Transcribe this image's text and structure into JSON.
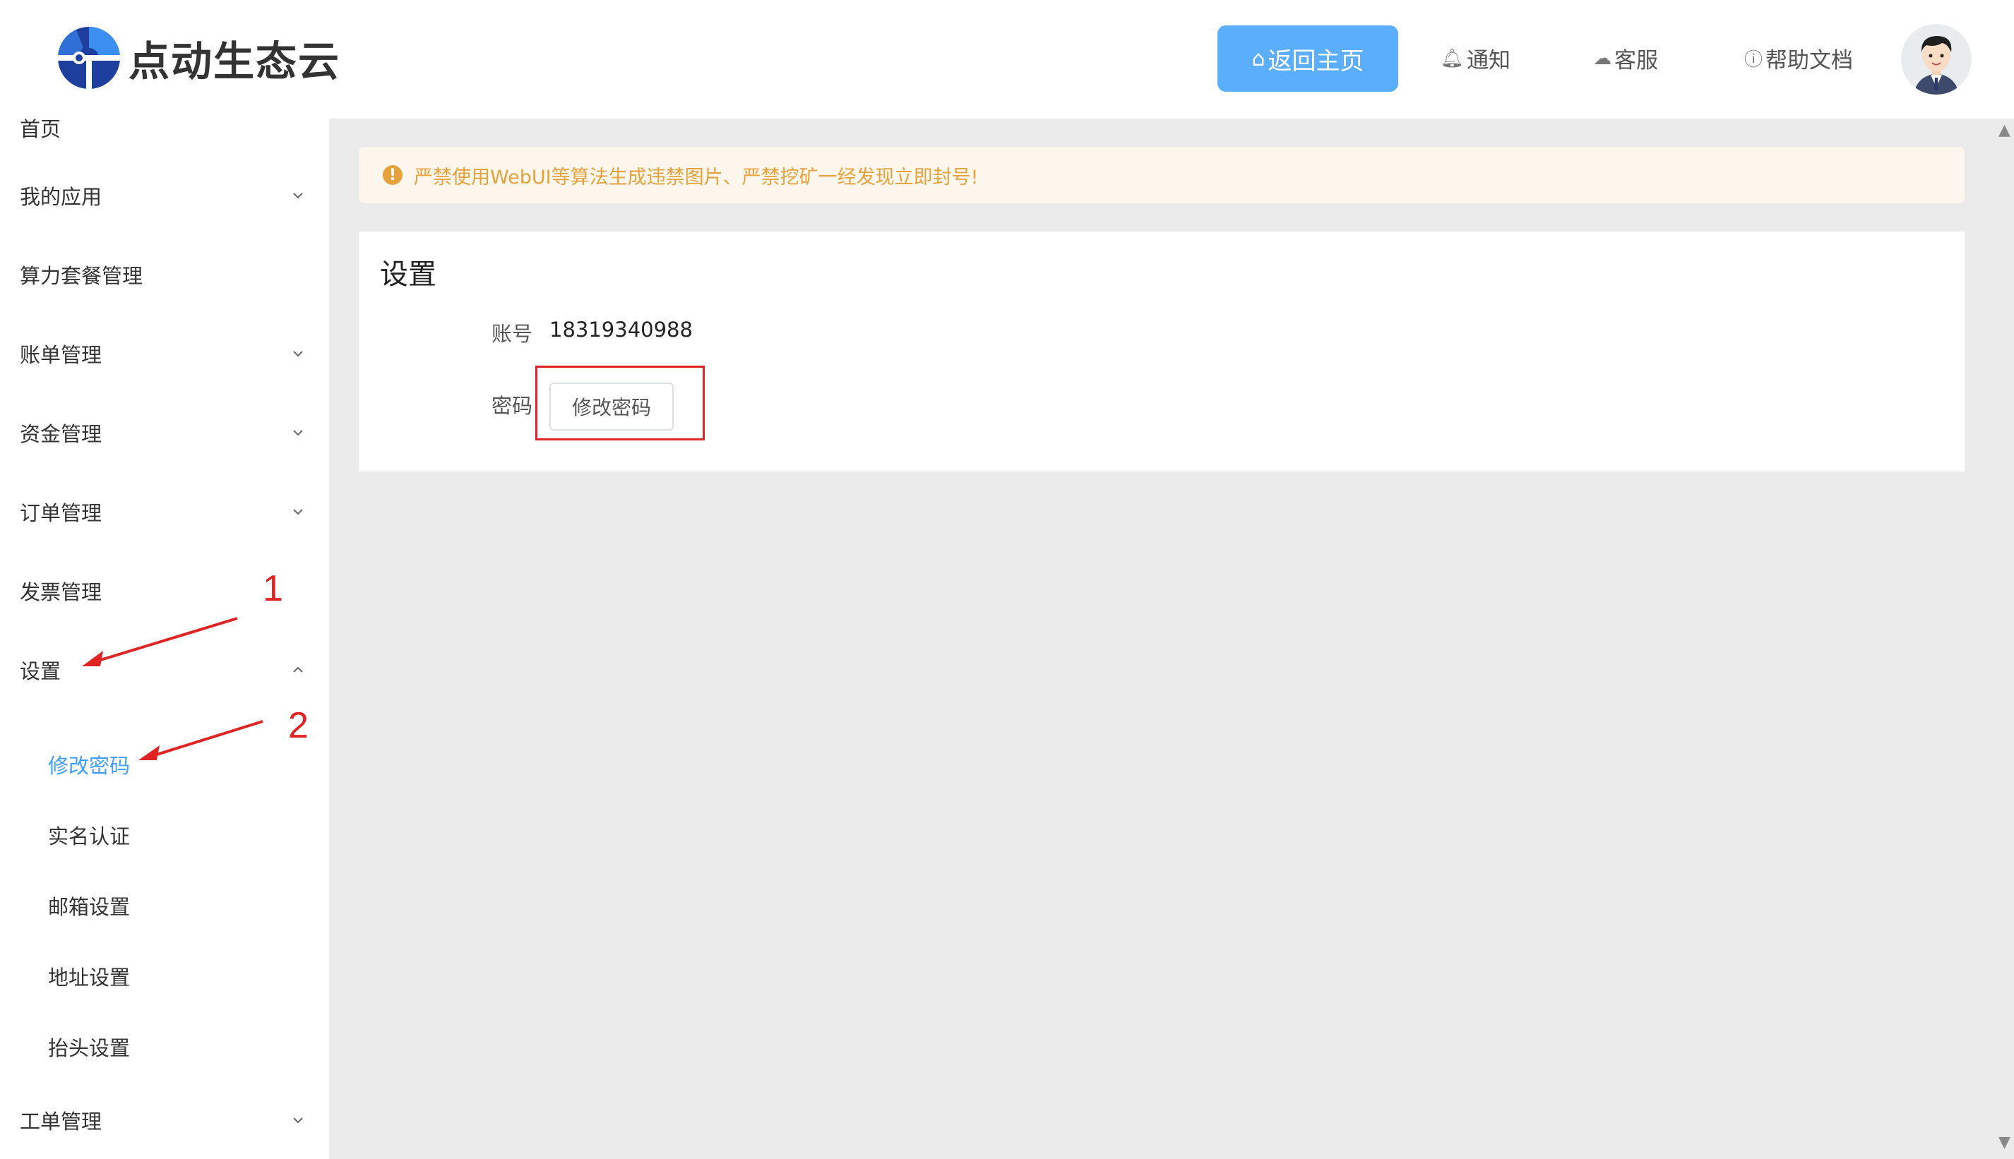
{
  "header": {
    "brand": "点动生态云",
    "home_label": "返回主页",
    "nav": [
      {
        "icon": "bell-icon",
        "label": "通知"
      },
      {
        "icon": "chat-icon",
        "label": "客服"
      },
      {
        "icon": "help-icon",
        "label": "帮助文档"
      }
    ]
  },
  "sidebar": {
    "partial_top": "首页",
    "items": [
      {
        "label": "我的应用"
      },
      {
        "label": "算力套餐管理"
      },
      {
        "label": "账单管理"
      },
      {
        "label": "资金管理"
      },
      {
        "label": "订单管理"
      },
      {
        "label": "发票管理"
      },
      {
        "label": "设置"
      },
      {
        "label": "工单管理"
      }
    ],
    "settings_sub": [
      {
        "label": "修改密码"
      },
      {
        "label": "实名认证"
      },
      {
        "label": "邮箱设置"
      },
      {
        "label": "地址设置"
      },
      {
        "label": "抬头设置"
      }
    ]
  },
  "annotations": [
    "1",
    "2"
  ],
  "alert": {
    "text": "严禁使用WebUI等算法生成违禁图片、严禁挖矿一经发现立即封号!"
  },
  "settings_card": {
    "title": "设置",
    "account_label": "账号",
    "account_value": "18319340988",
    "password_label": "密码",
    "change_password_button": "修改密码"
  },
  "colors": {
    "accent": "#409eff",
    "home_button": "#5aaefb",
    "warning": "#e6a23c",
    "annotation": "#e02424"
  }
}
